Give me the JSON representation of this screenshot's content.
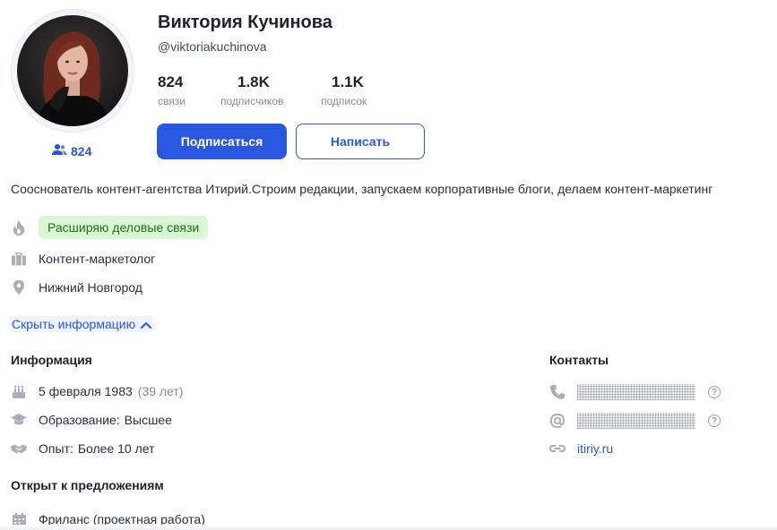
{
  "profile": {
    "name": "Виктория Кучинова",
    "handle": "@viktoriakuchinova",
    "connections_badge": "824"
  },
  "stats": [
    {
      "value": "824",
      "label": "связи"
    },
    {
      "value": "1.8K",
      "label": "подписчиков"
    },
    {
      "value": "1.1K",
      "label": "подписок"
    }
  ],
  "actions": {
    "subscribe": "Подписаться",
    "message": "Написать"
  },
  "about": "Сооснователь контент-агентства Итирий.Строим редакции, запускаем корпоративные блоги, делаем контент-маркетинг",
  "highlights": {
    "goal_tag": "Расширяю деловые связи",
    "job": "Контент-маркетолог",
    "city": "Нижний Новгород"
  },
  "toggle_label": "Скрыть информацию",
  "info": {
    "title": "Информация",
    "birthday": "5 февраля 1983",
    "age": "(39 лет)",
    "education_label": "Образование:",
    "education_value": "Высшее",
    "experience_label": "Опыт:",
    "experience_value": "Более 10 лет"
  },
  "contacts": {
    "title": "Контакты",
    "site": "itiriy.ru",
    "help_glyph": "?"
  },
  "open_to": {
    "title": "Открыт к предложениям",
    "item": "Фриланс (проектная работа)"
  },
  "icons": [
    "users-icon",
    "fire-icon",
    "briefcase-icon",
    "location-pin-icon",
    "chevron-up-icon",
    "cake-icon",
    "graduation-cap-icon",
    "handshake-icon",
    "phone-icon",
    "at-icon",
    "link-icon",
    "help-icon",
    "calendar-icon"
  ],
  "colors": {
    "accent": "#2a57e0",
    "tag_bg": "#d9f7d2",
    "tag_text": "#1f6d21"
  }
}
